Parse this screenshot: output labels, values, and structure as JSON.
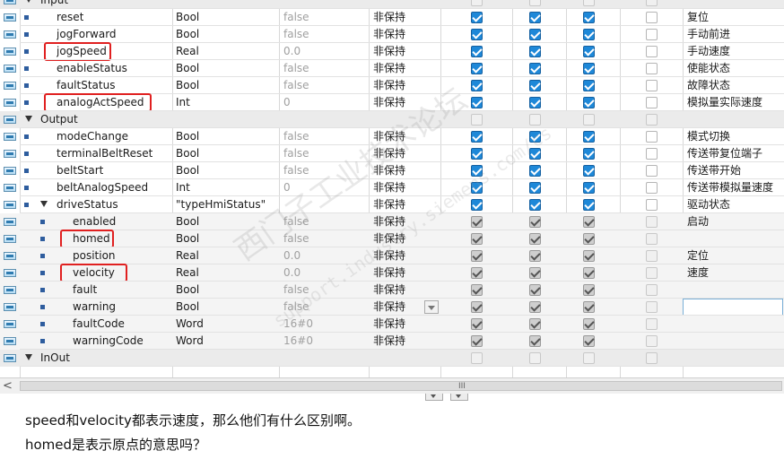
{
  "rows": [
    {
      "kind": "section",
      "name": "Input"
    },
    {
      "kind": "var",
      "level": 1,
      "name": "reset",
      "type": "Bool",
      "default": "false",
      "retain": "非保持",
      "c1": "on",
      "c2": "on",
      "c3": "on",
      "c4": "off",
      "comment": "复位"
    },
    {
      "kind": "var",
      "level": 1,
      "name": "jogForward",
      "type": "Bool",
      "default": "false",
      "retain": "非保持",
      "c1": "on",
      "c2": "on",
      "c3": "on",
      "c4": "off",
      "comment": "手动前进"
    },
    {
      "kind": "var",
      "level": 1,
      "name": "jogSpeed",
      "type": "Real",
      "default": "0.0",
      "retain": "非保持",
      "c1": "on",
      "c2": "on",
      "c3": "on",
      "c4": "off",
      "comment": "手动速度",
      "highlight": true
    },
    {
      "kind": "var",
      "level": 1,
      "name": "enableStatus",
      "type": "Bool",
      "default": "false",
      "retain": "非保持",
      "c1": "on",
      "c2": "on",
      "c3": "on",
      "c4": "off",
      "comment": "使能状态"
    },
    {
      "kind": "var",
      "level": 1,
      "name": "faultStatus",
      "type": "Bool",
      "default": "false",
      "retain": "非保持",
      "c1": "on",
      "c2": "on",
      "c3": "on",
      "c4": "off",
      "comment": "故障状态"
    },
    {
      "kind": "var",
      "level": 1,
      "name": "analogActSpeed",
      "type": "Int",
      "default": "0",
      "retain": "非保持",
      "c1": "on",
      "c2": "on",
      "c3": "on",
      "c4": "off",
      "comment": "模拟量实际速度",
      "highlight": true
    },
    {
      "kind": "section",
      "name": "Output"
    },
    {
      "kind": "var",
      "level": 1,
      "name": "modeChange",
      "type": "Bool",
      "default": "false",
      "retain": "非保持",
      "c1": "on",
      "c2": "on",
      "c3": "on",
      "c4": "off",
      "comment": "模式切换"
    },
    {
      "kind": "var",
      "level": 1,
      "name": "terminalBeltReset",
      "type": "Bool",
      "default": "false",
      "retain": "非保持",
      "c1": "on",
      "c2": "on",
      "c3": "on",
      "c4": "off",
      "comment": "传送带复位端子"
    },
    {
      "kind": "var",
      "level": 1,
      "name": "beltStart",
      "type": "Bool",
      "default": "false",
      "retain": "非保持",
      "c1": "on",
      "c2": "on",
      "c3": "on",
      "c4": "off",
      "comment": "传送带开始"
    },
    {
      "kind": "var",
      "level": 1,
      "name": "beltAnalogSpeed",
      "type": "Int",
      "default": "0",
      "retain": "非保持",
      "c1": "on",
      "c2": "on",
      "c3": "on",
      "c4": "off",
      "comment": "传送带模拟量速度"
    },
    {
      "kind": "struct",
      "level": 1,
      "name": "driveStatus",
      "type": "\"typeHmiStatus\"",
      "default": "",
      "retain": "非保持",
      "c1": "on",
      "c2": "on",
      "c3": "on",
      "c4": "off",
      "comment": "驱动状态"
    },
    {
      "kind": "var",
      "level": 2,
      "name": "enabled",
      "type": "Bool",
      "default": "false",
      "retain": "非保持",
      "c1": "grey",
      "c2": "grey",
      "c3": "grey",
      "c4": "offg",
      "comment": "启动"
    },
    {
      "kind": "var",
      "level": 2,
      "name": "homed",
      "type": "Bool",
      "default": "false",
      "retain": "非保持",
      "c1": "grey",
      "c2": "grey",
      "c3": "grey",
      "c4": "offg",
      "comment": "",
      "highlight": true
    },
    {
      "kind": "var",
      "level": 2,
      "name": "position",
      "type": "Real",
      "default": "0.0",
      "retain": "非保持",
      "c1": "grey",
      "c2": "grey",
      "c3": "grey",
      "c4": "offg",
      "comment": "定位"
    },
    {
      "kind": "var",
      "level": 2,
      "name": "velocity",
      "type": "Real",
      "default": "0.0",
      "retain": "非保持",
      "c1": "grey",
      "c2": "grey",
      "c3": "grey",
      "c4": "offg",
      "comment": "速度",
      "highlight": true
    },
    {
      "kind": "var",
      "level": 2,
      "name": "fault",
      "type": "Bool",
      "default": "false",
      "retain": "非保持",
      "c1": "grey",
      "c2": "grey",
      "c3": "grey",
      "c4": "offg",
      "comment": ""
    },
    {
      "kind": "var",
      "level": 2,
      "name": "warning",
      "type": "Bool",
      "default": "false",
      "retain": "非保持",
      "c1": "grey",
      "c2": "grey",
      "c3": "grey",
      "c4": "offg",
      "comment": "",
      "dropdown": true,
      "editing": true
    },
    {
      "kind": "var",
      "level": 2,
      "name": "faultCode",
      "type": "Word",
      "default": "16#0",
      "retain": "非保持",
      "c1": "grey",
      "c2": "grey",
      "c3": "grey",
      "c4": "offg",
      "comment": ""
    },
    {
      "kind": "var",
      "level": 2,
      "name": "warningCode",
      "type": "Word",
      "default": "16#0",
      "retain": "非保持",
      "c1": "grey",
      "c2": "grey",
      "c3": "grey",
      "c4": "offg",
      "comment": ""
    },
    {
      "kind": "section",
      "name": "InOut"
    }
  ],
  "question": {
    "line1": "speed和velocity都表示速度，那么他们有什么区别啊。",
    "line2": "homed是表示原点的意思吗？"
  },
  "watermark": {
    "line1": "西门子工业技术论坛",
    "line2": "support.industry.siemens.com/cs"
  },
  "scrollbar": {
    "left_arrow": "<",
    "grip": "III"
  },
  "colors": {
    "checkbox_on": "#1e88d8",
    "checkbox_inherited": "#cfcfcf",
    "highlight_box": "#e02020",
    "section_bg": "#ebebeb"
  }
}
